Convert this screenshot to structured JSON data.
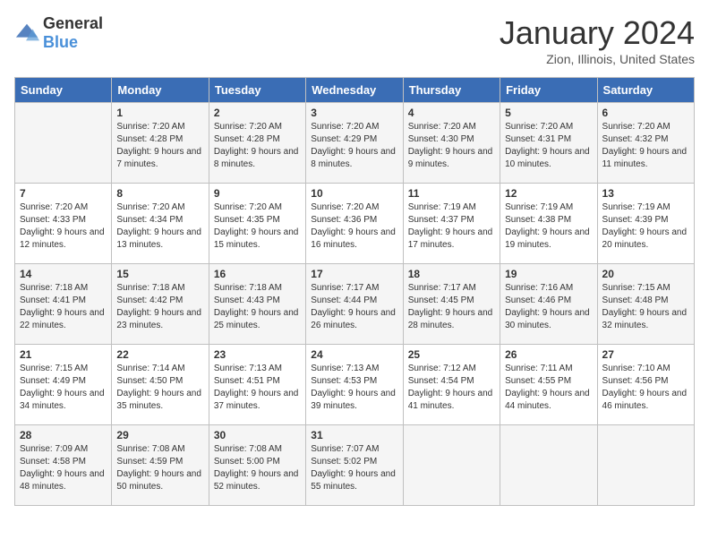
{
  "logo": {
    "text_general": "General",
    "text_blue": "Blue"
  },
  "header": {
    "month": "January 2024",
    "location": "Zion, Illinois, United States"
  },
  "days_of_week": [
    "Sunday",
    "Monday",
    "Tuesday",
    "Wednesday",
    "Thursday",
    "Friday",
    "Saturday"
  ],
  "weeks": [
    [
      {
        "day": "",
        "sunrise": "",
        "sunset": "",
        "daylight": ""
      },
      {
        "day": "1",
        "sunrise": "Sunrise: 7:20 AM",
        "sunset": "Sunset: 4:28 PM",
        "daylight": "Daylight: 9 hours and 7 minutes."
      },
      {
        "day": "2",
        "sunrise": "Sunrise: 7:20 AM",
        "sunset": "Sunset: 4:28 PM",
        "daylight": "Daylight: 9 hours and 8 minutes."
      },
      {
        "day": "3",
        "sunrise": "Sunrise: 7:20 AM",
        "sunset": "Sunset: 4:29 PM",
        "daylight": "Daylight: 9 hours and 8 minutes."
      },
      {
        "day": "4",
        "sunrise": "Sunrise: 7:20 AM",
        "sunset": "Sunset: 4:30 PM",
        "daylight": "Daylight: 9 hours and 9 minutes."
      },
      {
        "day": "5",
        "sunrise": "Sunrise: 7:20 AM",
        "sunset": "Sunset: 4:31 PM",
        "daylight": "Daylight: 9 hours and 10 minutes."
      },
      {
        "day": "6",
        "sunrise": "Sunrise: 7:20 AM",
        "sunset": "Sunset: 4:32 PM",
        "daylight": "Daylight: 9 hours and 11 minutes."
      }
    ],
    [
      {
        "day": "7",
        "sunrise": "Sunrise: 7:20 AM",
        "sunset": "Sunset: 4:33 PM",
        "daylight": "Daylight: 9 hours and 12 minutes."
      },
      {
        "day": "8",
        "sunrise": "Sunrise: 7:20 AM",
        "sunset": "Sunset: 4:34 PM",
        "daylight": "Daylight: 9 hours and 13 minutes."
      },
      {
        "day": "9",
        "sunrise": "Sunrise: 7:20 AM",
        "sunset": "Sunset: 4:35 PM",
        "daylight": "Daylight: 9 hours and 15 minutes."
      },
      {
        "day": "10",
        "sunrise": "Sunrise: 7:20 AM",
        "sunset": "Sunset: 4:36 PM",
        "daylight": "Daylight: 9 hours and 16 minutes."
      },
      {
        "day": "11",
        "sunrise": "Sunrise: 7:19 AM",
        "sunset": "Sunset: 4:37 PM",
        "daylight": "Daylight: 9 hours and 17 minutes."
      },
      {
        "day": "12",
        "sunrise": "Sunrise: 7:19 AM",
        "sunset": "Sunset: 4:38 PM",
        "daylight": "Daylight: 9 hours and 19 minutes."
      },
      {
        "day": "13",
        "sunrise": "Sunrise: 7:19 AM",
        "sunset": "Sunset: 4:39 PM",
        "daylight": "Daylight: 9 hours and 20 minutes."
      }
    ],
    [
      {
        "day": "14",
        "sunrise": "Sunrise: 7:18 AM",
        "sunset": "Sunset: 4:41 PM",
        "daylight": "Daylight: 9 hours and 22 minutes."
      },
      {
        "day": "15",
        "sunrise": "Sunrise: 7:18 AM",
        "sunset": "Sunset: 4:42 PM",
        "daylight": "Daylight: 9 hours and 23 minutes."
      },
      {
        "day": "16",
        "sunrise": "Sunrise: 7:18 AM",
        "sunset": "Sunset: 4:43 PM",
        "daylight": "Daylight: 9 hours and 25 minutes."
      },
      {
        "day": "17",
        "sunrise": "Sunrise: 7:17 AM",
        "sunset": "Sunset: 4:44 PM",
        "daylight": "Daylight: 9 hours and 26 minutes."
      },
      {
        "day": "18",
        "sunrise": "Sunrise: 7:17 AM",
        "sunset": "Sunset: 4:45 PM",
        "daylight": "Daylight: 9 hours and 28 minutes."
      },
      {
        "day": "19",
        "sunrise": "Sunrise: 7:16 AM",
        "sunset": "Sunset: 4:46 PM",
        "daylight": "Daylight: 9 hours and 30 minutes."
      },
      {
        "day": "20",
        "sunrise": "Sunrise: 7:15 AM",
        "sunset": "Sunset: 4:48 PM",
        "daylight": "Daylight: 9 hours and 32 minutes."
      }
    ],
    [
      {
        "day": "21",
        "sunrise": "Sunrise: 7:15 AM",
        "sunset": "Sunset: 4:49 PM",
        "daylight": "Daylight: 9 hours and 34 minutes."
      },
      {
        "day": "22",
        "sunrise": "Sunrise: 7:14 AM",
        "sunset": "Sunset: 4:50 PM",
        "daylight": "Daylight: 9 hours and 35 minutes."
      },
      {
        "day": "23",
        "sunrise": "Sunrise: 7:13 AM",
        "sunset": "Sunset: 4:51 PM",
        "daylight": "Daylight: 9 hours and 37 minutes."
      },
      {
        "day": "24",
        "sunrise": "Sunrise: 7:13 AM",
        "sunset": "Sunset: 4:53 PM",
        "daylight": "Daylight: 9 hours and 39 minutes."
      },
      {
        "day": "25",
        "sunrise": "Sunrise: 7:12 AM",
        "sunset": "Sunset: 4:54 PM",
        "daylight": "Daylight: 9 hours and 41 minutes."
      },
      {
        "day": "26",
        "sunrise": "Sunrise: 7:11 AM",
        "sunset": "Sunset: 4:55 PM",
        "daylight": "Daylight: 9 hours and 44 minutes."
      },
      {
        "day": "27",
        "sunrise": "Sunrise: 7:10 AM",
        "sunset": "Sunset: 4:56 PM",
        "daylight": "Daylight: 9 hours and 46 minutes."
      }
    ],
    [
      {
        "day": "28",
        "sunrise": "Sunrise: 7:09 AM",
        "sunset": "Sunset: 4:58 PM",
        "daylight": "Daylight: 9 hours and 48 minutes."
      },
      {
        "day": "29",
        "sunrise": "Sunrise: 7:08 AM",
        "sunset": "Sunset: 4:59 PM",
        "daylight": "Daylight: 9 hours and 50 minutes."
      },
      {
        "day": "30",
        "sunrise": "Sunrise: 7:08 AM",
        "sunset": "Sunset: 5:00 PM",
        "daylight": "Daylight: 9 hours and 52 minutes."
      },
      {
        "day": "31",
        "sunrise": "Sunrise: 7:07 AM",
        "sunset": "Sunset: 5:02 PM",
        "daylight": "Daylight: 9 hours and 55 minutes."
      },
      {
        "day": "",
        "sunrise": "",
        "sunset": "",
        "daylight": ""
      },
      {
        "day": "",
        "sunrise": "",
        "sunset": "",
        "daylight": ""
      },
      {
        "day": "",
        "sunrise": "",
        "sunset": "",
        "daylight": ""
      }
    ]
  ]
}
